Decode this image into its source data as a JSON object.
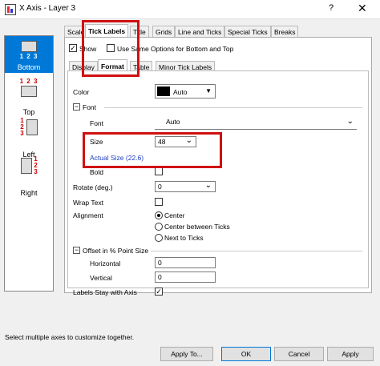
{
  "window": {
    "title": "X Axis - Layer 3",
    "help": "?",
    "close": "✕"
  },
  "axes": [
    {
      "label": "Bottom",
      "numbers": "1 2 3",
      "selected": true
    },
    {
      "label": "Top",
      "numbers": "1 2 3",
      "selected": false
    },
    {
      "label": "Left",
      "numbers": "1\n2\n3",
      "selected": false
    },
    {
      "label": "Right",
      "numbers": "1\n2\n3",
      "selected": false
    }
  ],
  "main_tabs": [
    "Scale",
    "Tick Labels",
    "Title",
    "Grids",
    "Line and Ticks",
    "Special Ticks",
    "Breaks"
  ],
  "main_tab_active": "Tick Labels",
  "show": {
    "label": "Show",
    "checked": true
  },
  "same_options": {
    "label": "Use Same Options for Bottom and Top",
    "checked": false
  },
  "sub_tabs": [
    "Display",
    "Format",
    "Table",
    "Minor Tick Labels"
  ],
  "sub_tab_active": "Format",
  "form": {
    "color_label": "Color",
    "color_value": "Auto",
    "color_swatch": "#000000",
    "font_section": "Font",
    "font_label": "Font",
    "font_value": "Auto",
    "size_label": "Size",
    "size_value": "48",
    "actual_size": "Actual Size (22.6)",
    "bold_label": "Bold",
    "rotate_label": "Rotate (deg.)",
    "rotate_value": "0",
    "wrap_label": "Wrap Text",
    "alignment_label": "Alignment",
    "align_options": [
      "Center",
      "Center between Ticks",
      "Next to Ticks"
    ],
    "align_selected": "Center",
    "offset_section": "Offset in % Point Size",
    "horizontal_label": "Horizontal",
    "horizontal_value": "0",
    "vertical_label": "Vertical",
    "vertical_value": "0",
    "stay_label": "Labels Stay with Axis",
    "stay_checked": true
  },
  "status_text": "Select multiple axes to customize together.",
  "buttons": {
    "apply_to": "Apply To...",
    "ok": "OK",
    "cancel": "Cancel",
    "apply": "Apply"
  },
  "accent_color": "#0078d7",
  "highlight_color": "#d01010"
}
